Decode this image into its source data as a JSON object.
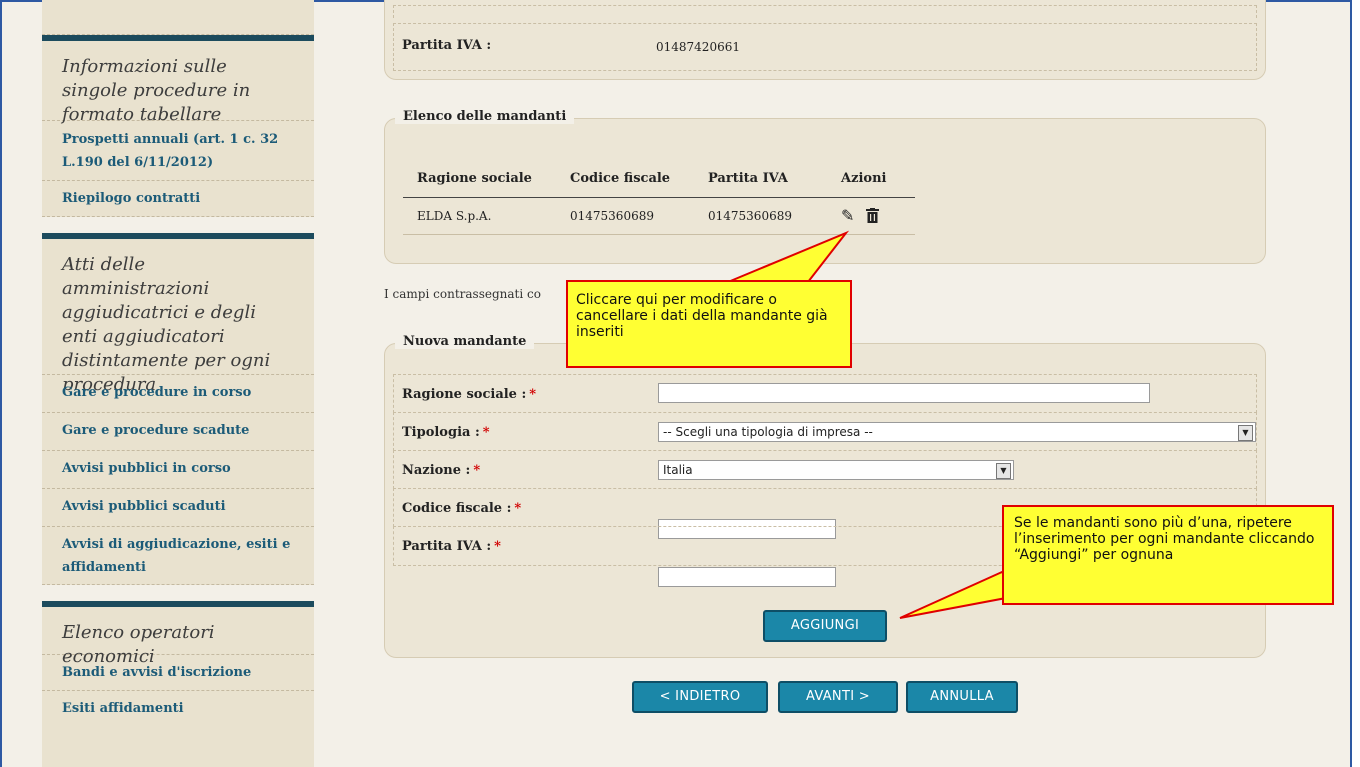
{
  "sidebar": {
    "sections": [
      {
        "title": "Informazioni sulle singole procedure in formato tabellare",
        "links": [
          "Prospetti annuali (art. 1 c. 32 L.190 del 6/11/2012)",
          "Riepilogo contratti"
        ]
      },
      {
        "title": "Atti delle amministrazioni aggiudicatrici e degli enti aggiudicatori distintamente per ogni procedura",
        "links": [
          "Gare e procedure in corso",
          "Gare e procedure scadute",
          "Avvisi pubblici in corso",
          "Avvisi pubblici scaduti",
          "Avvisi di aggiudicazione, esiti e affidamenti"
        ]
      },
      {
        "title": "Elenco operatori economici",
        "links": [
          "Bandi e avvisi d'iscrizione",
          "Esiti affidamenti"
        ]
      }
    ]
  },
  "top_box": {
    "label": "Partita IVA :",
    "value": "01487420661"
  },
  "mandanti": {
    "legend": "Elenco delle mandanti",
    "headers": [
      "Ragione sociale",
      "Codice fiscale",
      "Partita IVA",
      "Azioni"
    ],
    "rows": [
      {
        "ragione": "ELDA S.p.A.",
        "cf": "01475360689",
        "piva": "01475360689"
      }
    ],
    "icons": {
      "edit": "pencil-icon",
      "delete": "trash-icon"
    }
  },
  "note": "I campi contrassegnati co",
  "nuova": {
    "legend": "Nuova mandante",
    "ragione_label": "Ragione sociale :",
    "tipologia_label": "Tipologia :",
    "tipologia_value": "-- Scegli una tipologia di impresa --",
    "nazione_label": "Nazione :",
    "nazione_value": "Italia",
    "cf_label": "Codice fiscale :",
    "piva_label": "Partita IVA :",
    "required_mark": "*",
    "add_button": "AGGIUNGI"
  },
  "buttons": {
    "back": "< INDIETRO",
    "next": "AVANTI >",
    "cancel": "ANNULLA"
  },
  "callouts": {
    "edit": "Cliccare qui per modificare o cancellare i dati della mandante già inseriti",
    "add": "Se le mandanti sono più d’una, ripetere l’inserimento per ogni mandante cliccando “Aggiungi” per ognuna"
  },
  "colors": {
    "accent": "#1b87a8",
    "sidebar_bar": "#1c4b5d",
    "callout_bg": "#ffff33",
    "callout_border": "#e00000"
  }
}
